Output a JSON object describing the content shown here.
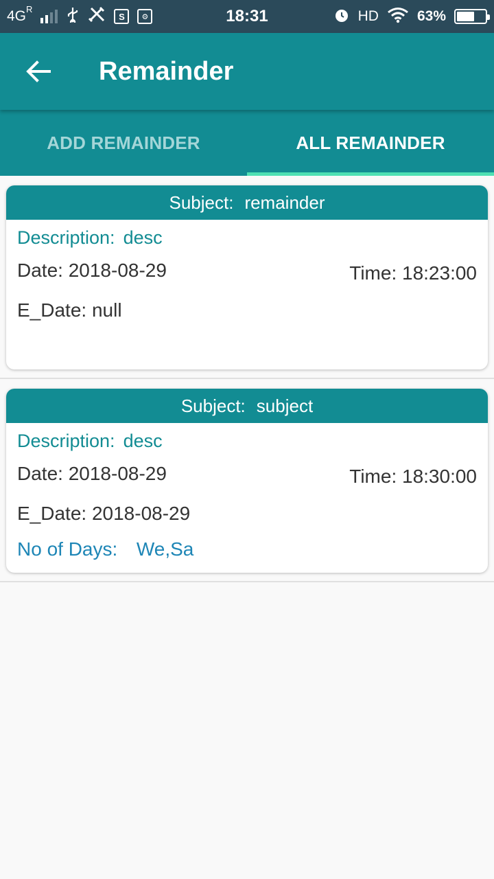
{
  "status_bar": {
    "network": "4G",
    "roaming": "R",
    "time": "18:31",
    "hd": "HD",
    "battery": "63%",
    "battery_level": 0.63
  },
  "app_bar": {
    "title": "Remainder"
  },
  "tabs": [
    {
      "label": "ADD REMAINDER",
      "active": false
    },
    {
      "label": "ALL REMAINDER",
      "active": true
    }
  ],
  "colors": {
    "primary": "#128c93",
    "status_bar": "#2b4a5a",
    "tab_indicator": "#4ee0b3",
    "days_text": "#1e86b6"
  },
  "reminders": [
    {
      "subject_label": "Subject:",
      "subject": "remainder",
      "description_label": "Description:",
      "description": "desc",
      "date": "Date: 2018-08-29",
      "time": "Time: 18:23:00",
      "edate": "E_Date: null"
    },
    {
      "subject_label": "Subject:",
      "subject": "subject",
      "description_label": "Description:",
      "description": "desc",
      "date": "Date: 2018-08-29",
      "time": "Time: 18:30:00",
      "edate": "E_Date: 2018-08-29",
      "days_label": "No of Days:",
      "days": "We,Sa"
    }
  ]
}
